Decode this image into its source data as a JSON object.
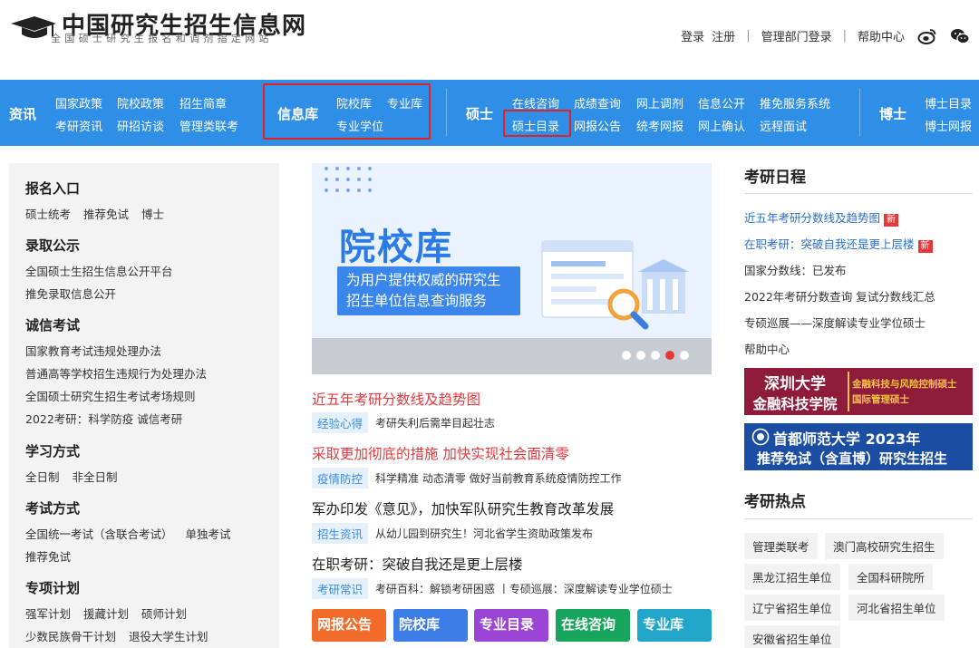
{
  "header": {
    "title": "中国研究生招生信息网",
    "subtitle": "全国硕士研究生报名和调剂指定网站",
    "links": {
      "login": "登录",
      "register": "注册",
      "admin_login": "管理部门登录",
      "help": "帮助中心"
    },
    "icons": [
      "weibo-icon",
      "wechat-icon"
    ]
  },
  "nav": {
    "groups": {
      "zixun": {
        "title": "资讯",
        "row1": [
          "国家政策",
          "院校政策",
          "招生简章"
        ],
        "row2": [
          "考研资讯",
          "研招访谈",
          "管理类联考"
        ]
      },
      "xinxiku": {
        "title": "信息库",
        "row1": [
          "院校库",
          "专业库"
        ],
        "row2": [
          "专业学位"
        ]
      },
      "shuoshi": {
        "title": "硕士",
        "row1": [
          "在线咨询",
          "成绩查询",
          "网上调剂",
          "信息公开",
          "推免服务系统"
        ],
        "row2": [
          "硕士目录",
          "网报公告",
          "统考网报",
          "网上确认",
          "远程面试"
        ]
      },
      "boshi": {
        "title": "博士",
        "row1": [
          "博士目录"
        ],
        "row2": [
          "博士网报"
        ]
      }
    }
  },
  "sidebar": {
    "sections": [
      {
        "title": "报名入口",
        "lines": [
          [
            "硕士统考",
            "推荐免试",
            "博士"
          ]
        ]
      },
      {
        "title": "录取公示",
        "lines": [
          [
            "全国硕士生招生信息公开平台"
          ],
          [
            "推免录取信息公开"
          ]
        ]
      },
      {
        "title": "诚信考试",
        "lines": [
          [
            "国家教育考试违规处理办法"
          ],
          [
            "普通高等学校招生违规行为处理办法"
          ],
          [
            "全国硕士研究生招生考试考场规则"
          ],
          [
            "2022考研：科学防疫 诚信考研"
          ]
        ]
      },
      {
        "title": "学习方式",
        "lines": [
          [
            "全日制",
            "非全日制"
          ]
        ]
      },
      {
        "title": "考试方式",
        "lines": [
          [
            "全国统一考试（含联合考试）",
            "单独考试"
          ],
          [
            "推荐免试"
          ]
        ]
      },
      {
        "title": "专项计划",
        "lines": [
          [
            "强军计划",
            "援藏计划",
            "硕师计划"
          ],
          [
            "少数民族骨干计划",
            "退役大学生计划"
          ]
        ]
      }
    ]
  },
  "banner": {
    "title": "院校库",
    "subtitle_line1": "为用户提供权威的研究生",
    "subtitle_line2": "招生单位信息查询服务"
  },
  "news": [
    {
      "title": "近五年考研分数线及趋势图",
      "color": "#e4393c",
      "tag": "经验心得",
      "desc": "考研失利后需举目起壮志"
    },
    {
      "title": "采取更加彻底的措施 加快实现社会面清零",
      "color": "#e4393c",
      "tag": "疫情防控",
      "desc": "科学精准 动态清零 做好当前教育系统疫情防控工作"
    },
    {
      "title": "军办印发《意见》，加快军队研究生教育改革发展",
      "color": "#222222",
      "tag": "招生资讯",
      "desc": "从幼儿园到研究生！河北省学生资助政策发布"
    },
    {
      "title": "在职考研：突破自我还是更上层楼",
      "color": "#222222",
      "tag": "考研常识",
      "desc": "考研百科：解锁考研困惑 丨专硕巡展：深度解读专业学位硕士"
    }
  ],
  "quick_links": [
    {
      "label": "网报公告",
      "color": "#f26b2a"
    },
    {
      "label": "院校库",
      "color": "#3d7de8"
    },
    {
      "label": "专业目录",
      "color": "#9a45d6"
    },
    {
      "label": "在线咨询",
      "color": "#17a55d"
    },
    {
      "label": "专业库",
      "color": "#21a5c9"
    }
  ],
  "schedule": {
    "title": "考研日程",
    "items": [
      {
        "text": "近五年考研分数线及趋势图",
        "new": "新",
        "color": "#2b6fc8"
      },
      {
        "text": "在职考研：突破自我还是更上层楼",
        "new": "新",
        "color": "#2b6fc8"
      },
      {
        "text": "国家分数线：已发布",
        "new": "",
        "color": "#333333"
      },
      {
        "text": "2022年考研分数查询 复试分数线汇总",
        "new": "",
        "color": "#333333"
      },
      {
        "text": "专硕巡展——深度解读专业学位硕士",
        "new": "",
        "color": "#333333"
      },
      {
        "text": "帮助中心",
        "new": "",
        "color": "#333333"
      }
    ]
  },
  "ads": {
    "szu_left_1": "深圳大学",
    "szu_left_2": "金融科技学院",
    "szu_right_1": "金融科技与风险控制硕士",
    "szu_right_2": "国际管理硕士",
    "cnu_1": "首都师范大学 2023年",
    "cnu_2": "推荐免试（含直博）研究生招生"
  },
  "hot": {
    "title": "考研热点",
    "chips": [
      [
        "管理类联考",
        "澳门高校研究生招生"
      ],
      [
        "黑龙江招生单位",
        "全国科研院所"
      ],
      [
        "辽宁省招生单位",
        "河北省招生单位"
      ],
      [
        "安徽省招生单位"
      ]
    ]
  },
  "colors": {
    "nav_bg": "#2f8ee5",
    "highlight": "#e42121",
    "accent": "#2b7be6"
  }
}
